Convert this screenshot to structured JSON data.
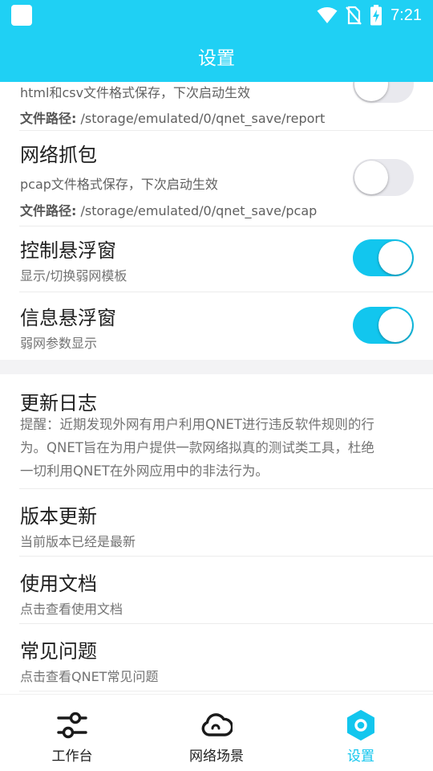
{
  "status_bar": {
    "time": "7:21"
  },
  "app_bar": {
    "title": "设置"
  },
  "settings": {
    "report_save": {
      "desc": "html和csv文件格式保存，下次启动生效",
      "path_label": "文件路径:",
      "path_value": " /storage/emulated/0/qnet_save/report",
      "enabled": false
    },
    "packet_capture": {
      "title": "网络抓包",
      "desc": "pcap文件格式保存，下次启动生效",
      "path_label": "文件路径:",
      "path_value": " /storage/emulated/0/qnet_save/pcap",
      "enabled": false
    },
    "control_float": {
      "title": "控制悬浮窗",
      "desc": "显示/切换弱网模板",
      "enabled": true
    },
    "info_float": {
      "title": "信息悬浮窗",
      "desc": "弱网参数显示",
      "enabled": true
    }
  },
  "about": {
    "changelog": {
      "title": "更新日志",
      "lines": [
        "提醒：近期发现外网有用户利用QNET进行违反软件规则的行",
        "为。QNET旨在为用户提供一款网络拟真的测试类工具，杜绝",
        "一切利用QNET在外网应用中的非法行为。"
      ]
    },
    "version": {
      "title": "版本更新",
      "desc": "当前版本已经是最新"
    },
    "docs": {
      "title": "使用文档",
      "desc": "点击查看使用文档"
    },
    "faq": {
      "title": "常见问题",
      "desc": "点击查看QNET常见问题"
    }
  },
  "bottom_nav": {
    "items": [
      {
        "label": "工作台",
        "icon": "sliders-icon",
        "active": false
      },
      {
        "label": "网络场景",
        "icon": "cloud-icon",
        "active": false
      },
      {
        "label": "设置",
        "icon": "hexagon-settings-icon",
        "active": true
      }
    ]
  },
  "colors": {
    "accent": "#1fd0f4",
    "toggle_on": "#12c6ee",
    "toggle_off": "#e9e9ee"
  }
}
